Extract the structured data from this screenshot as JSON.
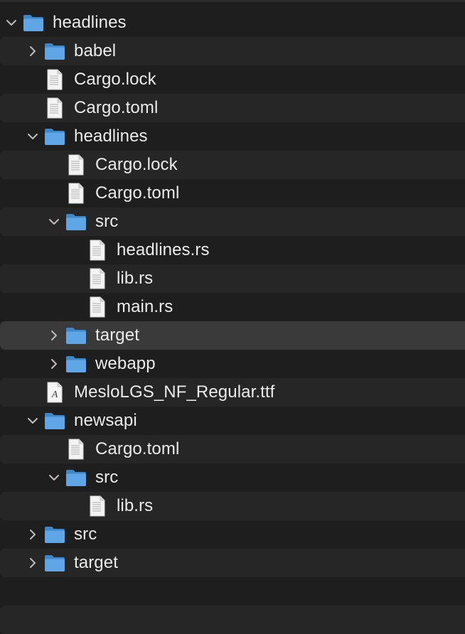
{
  "tree": [
    {
      "label": "headlines",
      "depth": 0,
      "kind": "folder",
      "state": "expanded",
      "stripe": false,
      "selected": false
    },
    {
      "label": "babel",
      "depth": 1,
      "kind": "folder",
      "state": "collapsed",
      "stripe": true,
      "selected": false
    },
    {
      "label": "Cargo.lock",
      "depth": 1,
      "kind": "file",
      "state": "none",
      "stripe": false,
      "selected": false
    },
    {
      "label": "Cargo.toml",
      "depth": 1,
      "kind": "file",
      "state": "none",
      "stripe": true,
      "selected": false
    },
    {
      "label": "headlines",
      "depth": 1,
      "kind": "folder",
      "state": "expanded",
      "stripe": false,
      "selected": false
    },
    {
      "label": "Cargo.lock",
      "depth": 2,
      "kind": "file",
      "state": "none",
      "stripe": true,
      "selected": false
    },
    {
      "label": "Cargo.toml",
      "depth": 2,
      "kind": "file",
      "state": "none",
      "stripe": false,
      "selected": false
    },
    {
      "label": "src",
      "depth": 2,
      "kind": "folder",
      "state": "expanded",
      "stripe": true,
      "selected": false
    },
    {
      "label": "headlines.rs",
      "depth": 3,
      "kind": "file",
      "state": "none",
      "stripe": false,
      "selected": false
    },
    {
      "label": "lib.rs",
      "depth": 3,
      "kind": "file",
      "state": "none",
      "stripe": true,
      "selected": false
    },
    {
      "label": "main.rs",
      "depth": 3,
      "kind": "file",
      "state": "none",
      "stripe": false,
      "selected": false
    },
    {
      "label": "target",
      "depth": 2,
      "kind": "folder",
      "state": "collapsed",
      "stripe": false,
      "selected": true
    },
    {
      "label": "webapp",
      "depth": 2,
      "kind": "folder",
      "state": "collapsed",
      "stripe": false,
      "selected": false
    },
    {
      "label": "MesloLGS_NF_Regular.ttf",
      "depth": 1,
      "kind": "font",
      "state": "none",
      "stripe": true,
      "selected": false
    },
    {
      "label": "newsapi",
      "depth": 1,
      "kind": "folder",
      "state": "expanded",
      "stripe": false,
      "selected": false
    },
    {
      "label": "Cargo.toml",
      "depth": 2,
      "kind": "file",
      "state": "none",
      "stripe": true,
      "selected": false
    },
    {
      "label": "src",
      "depth": 2,
      "kind": "folder",
      "state": "expanded",
      "stripe": false,
      "selected": false
    },
    {
      "label": "lib.rs",
      "depth": 3,
      "kind": "file",
      "state": "none",
      "stripe": true,
      "selected": false
    },
    {
      "label": "src",
      "depth": 1,
      "kind": "folder",
      "state": "collapsed",
      "stripe": false,
      "selected": false
    },
    {
      "label": "target",
      "depth": 1,
      "kind": "folder",
      "state": "collapsed",
      "stripe": true,
      "selected": false
    }
  ],
  "colors": {
    "background": "#1e1e1e",
    "stripe": "#262626",
    "selected": "#3a3a3a",
    "folder": "#5ea6e6",
    "text": "#ebebeb"
  },
  "icons": {
    "folder": "folder-icon",
    "file": "document-icon",
    "font": "font-file-icon",
    "expanded": "chevron-down-icon",
    "collapsed": "chevron-right-icon"
  }
}
